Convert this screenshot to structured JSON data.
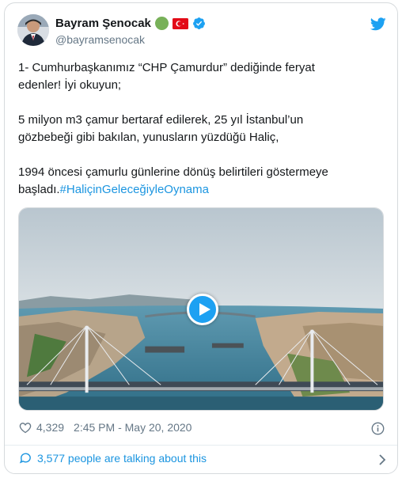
{
  "author": {
    "display_name": "Bayram Şenocak",
    "handle": "@bayramsenocak",
    "verified": true
  },
  "tweet": {
    "line1": "1- Cumhurbaşkanımız “CHP Çamurdur” dediğinde feryat",
    "line2": "edenler! İyi okuyun;",
    "line3": "5 milyon m3 çamur bertaraf edilerek, 25 yıl İstanbul’un",
    "line4": "gözbebeği gibi bakılan, yunusların yüzdüğü Haliç,",
    "line5": "1994 öncesi çamurlu günlerine dönüş belirtileri göstermeye",
    "line6_prefix": "başladı.",
    "hashtag": "#HaliçinGeleceğiyleOynama"
  },
  "media": {
    "type": "video",
    "play_icon": "play-icon"
  },
  "meta": {
    "likes": "4,329",
    "timestamp": "2:45 PM - May 20, 2020"
  },
  "footer": {
    "conversation": "3,577 people are talking about this"
  },
  "colors": {
    "accent": "#1da1f2",
    "link": "#1b95e0",
    "text": "#14171a",
    "muted": "#657786"
  }
}
